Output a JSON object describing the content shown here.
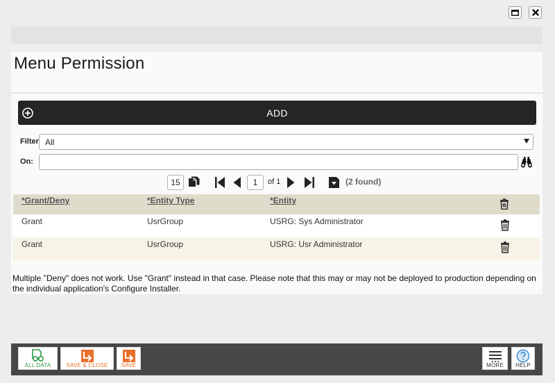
{
  "window": {
    "maximize_label": "maximize",
    "close_label": "close"
  },
  "page": {
    "title": "Menu Permission"
  },
  "add_bar": {
    "label": "ADD"
  },
  "filter": {
    "label": "Filter:",
    "selected": "All",
    "options": [
      "All"
    ]
  },
  "on": {
    "label": "On:",
    "value": "",
    "placeholder": ""
  },
  "pager": {
    "page_size": "15",
    "current_page": "1",
    "of_text": "of 1",
    "found_text": "(2 found)"
  },
  "table": {
    "columns": [
      "*Grant/Deny",
      "*Entity Type",
      "*Entity"
    ],
    "rows": [
      {
        "grant_deny": "Grant",
        "entity_type": "UsrGroup",
        "entity": "USRG: Sys Administrator"
      },
      {
        "grant_deny": "Grant",
        "entity_type": "UsrGroup",
        "entity": "USRG: Usr Administrator"
      }
    ]
  },
  "note": "Multiple \"Deny\" does not work. Use \"Grant\" instead in that case. Please note that this may or may not be deployed to production depending on the individual application's Configure Installer.",
  "toolbar": {
    "all_data_label": "ALL DATA",
    "save_close_label": "SAVE & CLOSE",
    "save_label": "SAVE",
    "more_label": "MORE",
    "help_label": "HELP"
  },
  "colors": {
    "add_bar_bg": "#252525",
    "grid_header_bg": "#e0dccc",
    "alt_row_bg": "#f7f3e6",
    "all_data_green": "#2e9a44",
    "save_orange": "#e8702a",
    "help_blue": "#3d8fd1",
    "bottom_bar": "#474747"
  }
}
